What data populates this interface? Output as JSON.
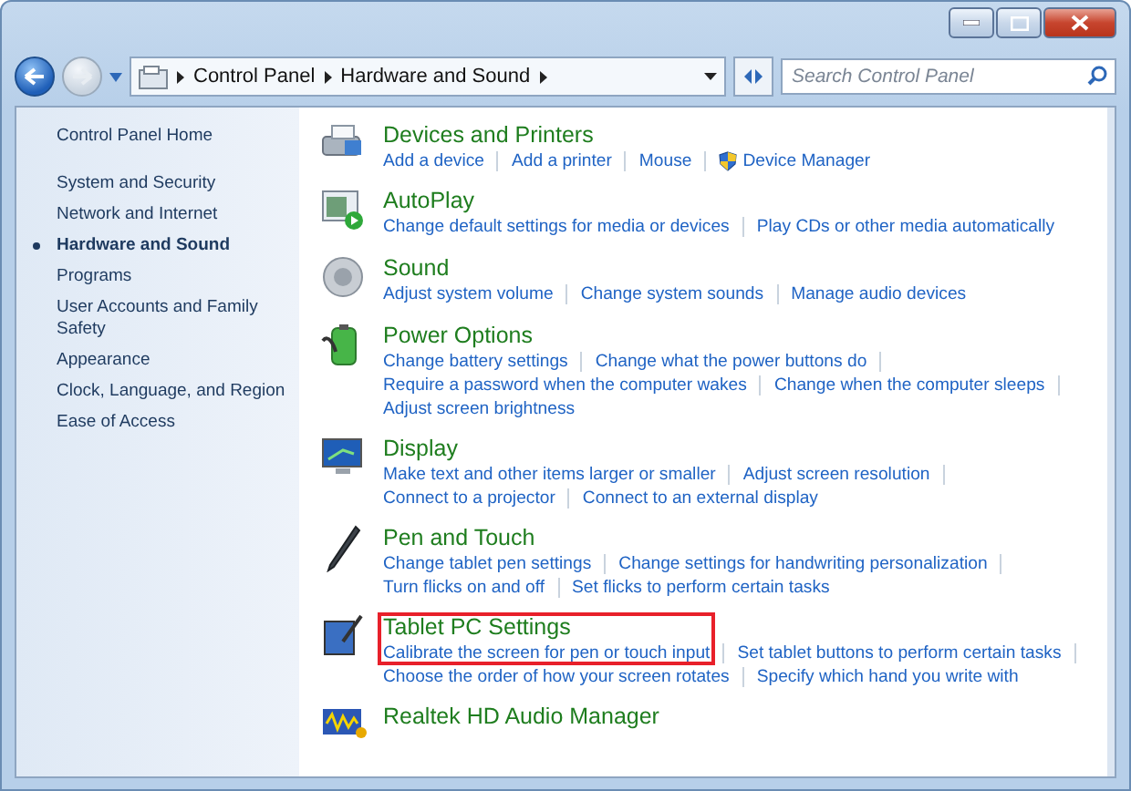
{
  "address_bar": {
    "breadcrumbs": [
      "Control Panel",
      "Hardware and Sound"
    ]
  },
  "search": {
    "placeholder": "Search Control Panel"
  },
  "sidebar": {
    "home": "Control Panel Home",
    "items": [
      {
        "label": "System and Security",
        "selected": false
      },
      {
        "label": "Network and Internet",
        "selected": false
      },
      {
        "label": "Hardware and Sound",
        "selected": true
      },
      {
        "label": "Programs",
        "selected": false
      },
      {
        "label": "User Accounts and Family Safety",
        "selected": false
      },
      {
        "label": "Appearance",
        "selected": false
      },
      {
        "label": "Clock, Language, and Region",
        "selected": false
      },
      {
        "label": "Ease of Access",
        "selected": false
      }
    ]
  },
  "categories": [
    {
      "title": "Devices and Printers",
      "kind": "printer",
      "highlighted": false,
      "lines": [
        [
          {
            "label": "Add a device",
            "shield": false
          },
          {
            "label": "Add a printer",
            "shield": false
          },
          {
            "label": "Mouse",
            "shield": false
          },
          {
            "label": "Device Manager",
            "shield": true
          }
        ]
      ]
    },
    {
      "title": "AutoPlay",
      "kind": "autoplay",
      "highlighted": false,
      "lines": [
        [
          {
            "label": "Change default settings for media or devices",
            "shield": false
          },
          {
            "label": "Play CDs or other media automatically",
            "shield": false
          }
        ]
      ]
    },
    {
      "title": "Sound",
      "kind": "speaker",
      "highlighted": false,
      "lines": [
        [
          {
            "label": "Adjust system volume",
            "shield": false
          },
          {
            "label": "Change system sounds",
            "shield": false
          },
          {
            "label": "Manage audio devices",
            "shield": false
          }
        ]
      ]
    },
    {
      "title": "Power Options",
      "kind": "battery",
      "highlighted": false,
      "lines": [
        [
          {
            "label": "Change battery settings",
            "shield": false
          },
          {
            "label": "Change what the power buttons do",
            "shield": false
          }
        ],
        [
          {
            "label": "Require a password when the computer wakes",
            "shield": false
          },
          {
            "label": "Change when the computer sleeps",
            "shield": false
          }
        ],
        [
          {
            "label": "Adjust screen brightness",
            "shield": false
          }
        ]
      ]
    },
    {
      "title": "Display",
      "kind": "monitor",
      "highlighted": false,
      "lines": [
        [
          {
            "label": "Make text and other items larger or smaller",
            "shield": false
          },
          {
            "label": "Adjust screen resolution",
            "shield": false
          }
        ],
        [
          {
            "label": "Connect to a projector",
            "shield": false
          },
          {
            "label": "Connect to an external display",
            "shield": false
          }
        ]
      ]
    },
    {
      "title": "Pen and Touch",
      "kind": "pen",
      "highlighted": false,
      "lines": [
        [
          {
            "label": "Change tablet pen settings",
            "shield": false
          },
          {
            "label": "Change settings for handwriting personalization",
            "shield": false
          }
        ],
        [
          {
            "label": "Turn flicks on and off",
            "shield": false
          },
          {
            "label": "Set flicks to perform certain tasks",
            "shield": false
          }
        ]
      ]
    },
    {
      "title": "Tablet PC Settings",
      "kind": "tablet",
      "highlighted": true,
      "lines": [
        [
          {
            "label": "Calibrate the screen for pen or touch input",
            "shield": false
          },
          {
            "label": "Set tablet buttons to perform certain tasks",
            "shield": false
          }
        ],
        [
          {
            "label": "Choose the order of how your screen rotates",
            "shield": false
          },
          {
            "label": "Specify which hand you write with",
            "shield": false
          }
        ]
      ]
    },
    {
      "title": "Realtek HD Audio Manager",
      "kind": "audio",
      "highlighted": false
    }
  ]
}
